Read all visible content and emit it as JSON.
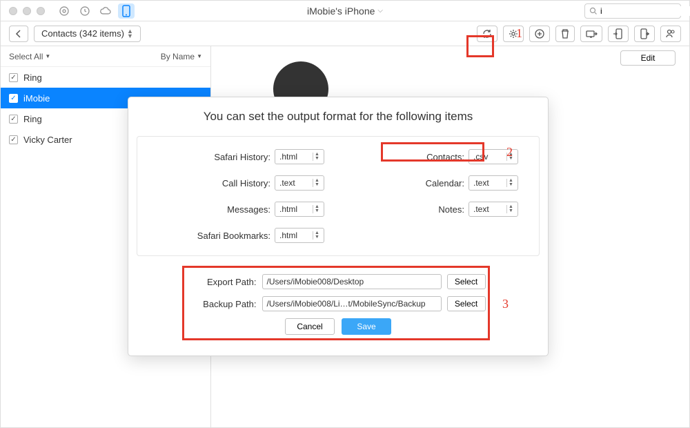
{
  "title": "iMobie's iPhone",
  "search": {
    "value": "i"
  },
  "crumb": "Contacts (342 items)",
  "sidebar": {
    "selectAll": "Select All",
    "sort": "By Name",
    "items": [
      {
        "label": "Ring"
      },
      {
        "label": "iMobie"
      },
      {
        "label": "Ring"
      },
      {
        "label": "Vicky Carter"
      }
    ]
  },
  "editLabel": "Edit",
  "dialog": {
    "title": "You can set the output format for the following items",
    "fmt": {
      "safariHistory": {
        "label": "Safari History:",
        "val": ".html"
      },
      "callHistory": {
        "label": "Call History:",
        "val": ".text"
      },
      "messages": {
        "label": "Messages:",
        "val": ".html"
      },
      "safariBookmarks": {
        "label": "Safari Bookmarks:",
        "val": ".html"
      },
      "contacts": {
        "label": "Contacts:",
        "val": ".csv"
      },
      "calendar": {
        "label": "Calendar:",
        "val": ".text"
      },
      "notes": {
        "label": "Notes:",
        "val": ".text"
      }
    },
    "export": {
      "label": "Export Path:",
      "val": "/Users/iMobie008/Desktop",
      "btn": "Select"
    },
    "backup": {
      "label": "Backup Path:",
      "val": "/Users/iMobie008/Li…t/MobileSync/Backup",
      "btn": "Select"
    },
    "cancel": "Cancel",
    "save": "Save"
  },
  "annot": {
    "n1": "1",
    "n2": "2",
    "n3": "3"
  }
}
